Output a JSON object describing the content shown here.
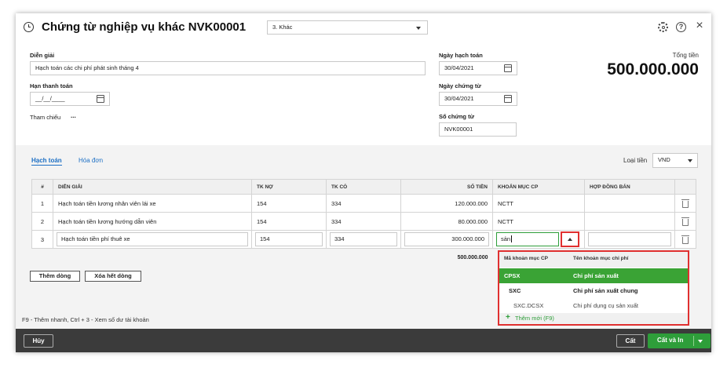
{
  "header": {
    "title": "Chứng từ nghiệp vụ khác NVK00001",
    "type_select": "3. Khác"
  },
  "form": {
    "dien_giai_label": "Diễn giải",
    "dien_giai_value": "Hạch toán các chi phí phát sinh tháng 4",
    "han_thanh_toan_label": "Hạn thanh toán",
    "han_thanh_toan_value": "__/__/____",
    "tham_chieu_label": "Tham chiếu",
    "tham_chieu_more": "...",
    "ngay_hach_toan_label": "Ngày hạch toán",
    "ngay_hach_toan_value": "30/04/2021",
    "ngay_chung_tu_label": "Ngày chứng từ",
    "ngay_chung_tu_value": "30/04/2021",
    "so_chung_tu_label": "Số chứng từ",
    "so_chung_tu_value": "NVK00001",
    "tong_tien_label": "Tổng tiền",
    "tong_tien_value": "500.000.000"
  },
  "tabs": {
    "hach_toan": "Hạch toán",
    "hoa_don": "Hóa đơn"
  },
  "currency": {
    "label": "Loại tiền",
    "value": "VND"
  },
  "grid": {
    "headers": [
      "#",
      "DIỄN GIẢI",
      "TK NỢ",
      "TK CÓ",
      "SỐ TIỀN",
      "KHOẢN MỤC CP",
      "HỢP ĐỒNG BÁN"
    ],
    "rows": [
      {
        "no": "1",
        "dien_giai": "Hạch toán tiền lương nhân viên lái xe",
        "tk_no": "154",
        "tk_co": "334",
        "so_tien": "120.000.000",
        "khoan_muc": "NCTT",
        "hop_dong": ""
      },
      {
        "no": "2",
        "dien_giai": "Hạch toán tiền lương hướng dẫn viên",
        "tk_no": "154",
        "tk_co": "334",
        "so_tien": "80.000.000",
        "khoan_muc": "NCTT",
        "hop_dong": ""
      },
      {
        "no": "3",
        "dien_giai": "Hạch toán tiền phí thuê xe",
        "tk_no": "154",
        "tk_co": "334",
        "so_tien": "300.000.000",
        "khoan_muc": "sản",
        "hop_dong": ""
      }
    ],
    "total": "500.000.000"
  },
  "buttons": {
    "add_row": "Thêm dòng",
    "clear_rows": "Xóa hết dòng",
    "cancel": "Hủy",
    "save": "Cất",
    "save_and_print": "Cất và In"
  },
  "dropdown": {
    "col1": "Mã khoản mục CP",
    "col2": "Tên khoản mục chi phí",
    "items": [
      {
        "code": "CPSX",
        "name": "Chi phí sản xuất"
      },
      {
        "code": "SXC",
        "name": "Chi phí sản xuất chung"
      },
      {
        "code": "SXC.DCSX",
        "name": "Chi phí dụng cụ sản xuất"
      }
    ],
    "add_new": "Thêm mới (F9)"
  },
  "footer_hint": "F9 - Thêm nhanh, Ctrl + 3 - Xem số dư tài khoản",
  "colors": {
    "accent_green": "#2e9e3a",
    "selected_row": "#3aa335",
    "highlight_border": "#e03030",
    "link_blue": "#1c6fc4"
  }
}
